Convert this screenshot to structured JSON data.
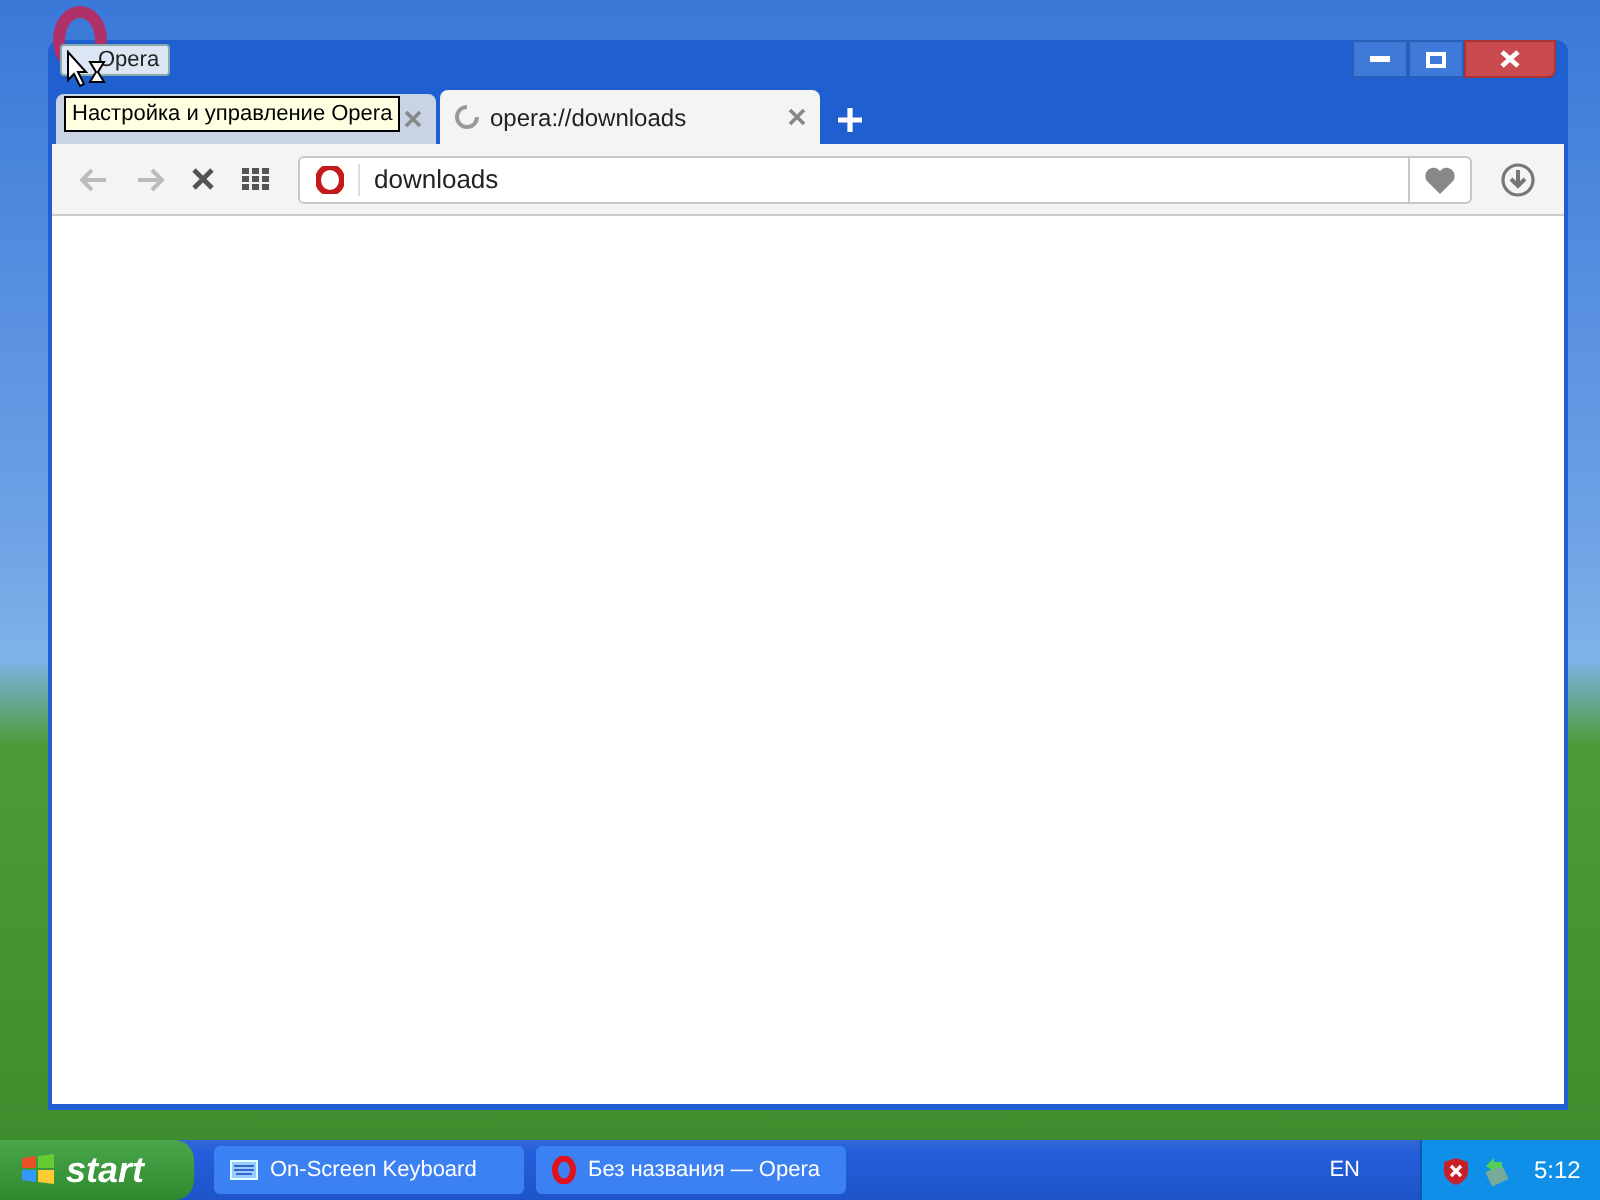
{
  "opera_menu": {
    "label": "Opera"
  },
  "tooltip": {
    "text": "Настройка и управление Opera"
  },
  "tabs": [
    {
      "selected": false
    },
    {
      "title": "opera://downloads",
      "selected": true
    }
  ],
  "address_bar": {
    "value": "downloads"
  },
  "taskbar": {
    "start_label": "start",
    "tasks": [
      {
        "label": "On-Screen Keyboard",
        "kind": "keyboard"
      },
      {
        "label": "Без названия — Opera",
        "kind": "opera"
      }
    ],
    "language": "EN",
    "clock": "5:12"
  }
}
